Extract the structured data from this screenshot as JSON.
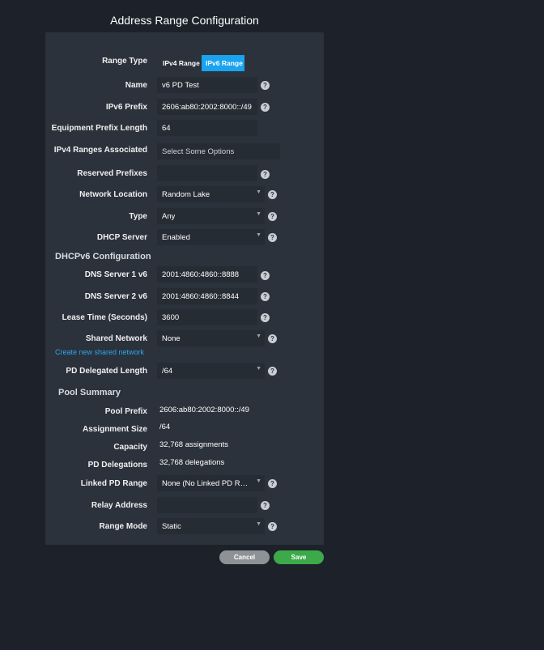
{
  "dialog_title": "Address Range Configuration",
  "range_type": {
    "label": "Range Type",
    "options": [
      "IPv4 Range",
      "IPv6 Range"
    ],
    "selected": "IPv6 Range",
    "active_color": "#1aa3f0"
  },
  "fields": {
    "name": {
      "label": "Name",
      "value": "v6  PD Test"
    },
    "ipv6_prefix": {
      "label": "IPv6 Prefix",
      "value": "2606:ab80:2002:8000::/49"
    },
    "equipment_prefix_length": {
      "label": "Equipment Prefix Length",
      "value": "64"
    },
    "ipv4_ranges_associated": {
      "label": "IPv4 Ranges Associated",
      "placeholder": "Select Some Options"
    },
    "reserved_prefixes": {
      "label": "Reserved Prefixes",
      "value": ""
    },
    "network_location": {
      "label": "Network Location",
      "value": "Random Lake"
    },
    "type": {
      "label": "Type",
      "value": "Any"
    },
    "dhcp_server": {
      "label": "DHCP Server",
      "value": "Enabled"
    }
  },
  "dhcpv6": {
    "heading": "DHCPv6 Configuration",
    "dns1": {
      "label": "DNS Server 1 v6",
      "value": "2001:4860:4860::8888"
    },
    "dns2": {
      "label": "DNS Server 2 v6",
      "value": "2001:4860:4860::8844"
    },
    "lease_time": {
      "label": "Lease Time (Seconds)",
      "value": "3600"
    },
    "shared_network": {
      "label": "Shared Network",
      "value": "None"
    },
    "create_link": "Create new shared network",
    "pd_delegated_length": {
      "label": "PD Delegated Length",
      "value": "/64"
    }
  },
  "pool_summary": {
    "heading": "Pool Summary",
    "pool_prefix": {
      "label": "Pool Prefix",
      "value": "2606:ab80:2002:8000::/49"
    },
    "assignment_size": {
      "label": "Assignment Size",
      "value": "/64"
    },
    "capacity": {
      "label": "Capacity",
      "value": "32,768 assignments"
    },
    "pd_delegations": {
      "label": "PD Delegations",
      "value": "32,768 delegations"
    },
    "linked_pd_range": {
      "label": "Linked PD Range",
      "value": "None (No Linked PD Range)"
    },
    "relay_address": {
      "label": "Relay Address",
      "value": ""
    },
    "range_mode": {
      "label": "Range Mode",
      "value": "Static"
    }
  },
  "buttons": {
    "cancel": "Cancel",
    "save": "Save"
  },
  "icons": {
    "help": "?",
    "caret": "▼"
  },
  "colors": {
    "save": "#3daa4a",
    "cancel": "#8e9296",
    "link": "#2aa7f0"
  }
}
